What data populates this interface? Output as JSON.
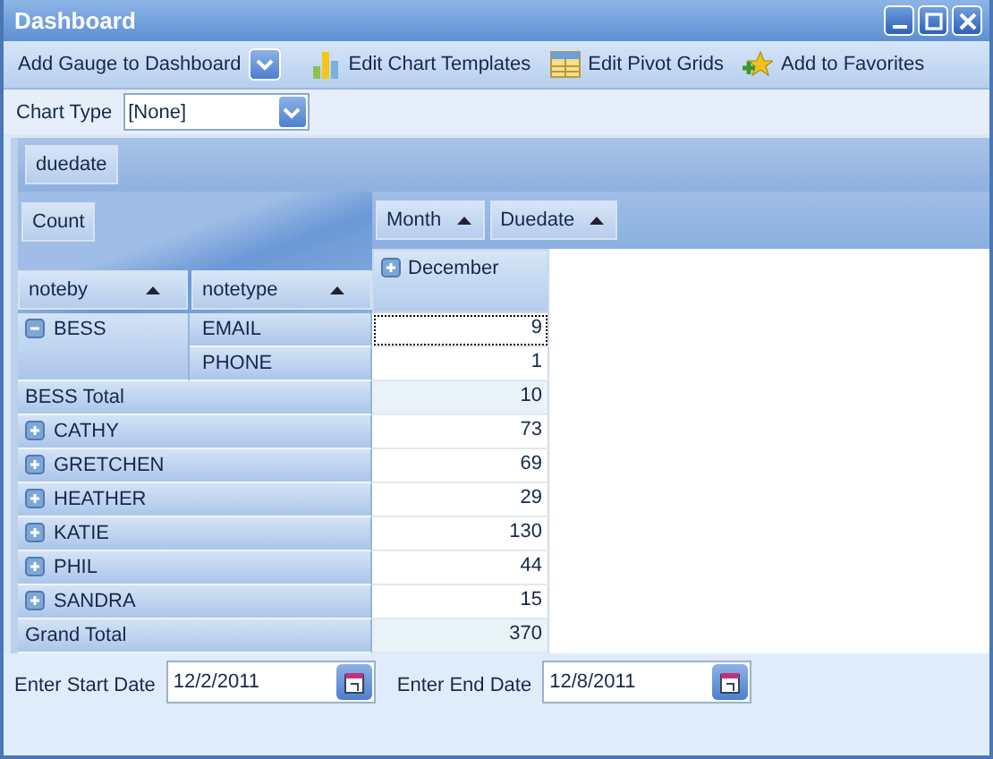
{
  "window": {
    "title": "Dashboard"
  },
  "toolbar": [
    {
      "label": "Add Gauge to Dashboard",
      "kind": "dropdown"
    },
    {
      "label": "Edit Chart Templates",
      "kind": "chart"
    },
    {
      "label": "Edit Pivot Grids",
      "kind": "grid"
    },
    {
      "label": "Add to Favorites",
      "kind": "favorite"
    }
  ],
  "chart_type": {
    "label": "Chart Type",
    "value": "[None]"
  },
  "pivot": {
    "filter_fields": [
      "duedate"
    ],
    "data_fields": [
      "Count"
    ],
    "column_fields": [
      "Month",
      "Duedate"
    ],
    "row_fields": [
      "noteby",
      "notetype"
    ],
    "column_values": [
      {
        "label": "December",
        "expanded": false
      }
    ],
    "rows": [
      {
        "kind": "member",
        "label": "BESS",
        "expanded": true,
        "children": [
          {
            "label": "EMAIL",
            "value": "9",
            "selected": true
          },
          {
            "label": "PHONE",
            "value": "1",
            "selected": false
          }
        ]
      },
      {
        "kind": "total",
        "label": "BESS Total",
        "value": "10",
        "selected": false
      },
      {
        "kind": "member",
        "label": "CATHY",
        "expanded": false,
        "value": "73",
        "selected": false
      },
      {
        "kind": "member",
        "label": "GRETCHEN",
        "expanded": false,
        "value": "69",
        "selected": false
      },
      {
        "kind": "member",
        "label": "HEATHER",
        "expanded": false,
        "value": "29",
        "selected": false
      },
      {
        "kind": "member",
        "label": "KATIE",
        "expanded": false,
        "value": "130",
        "selected": false
      },
      {
        "kind": "member",
        "label": "PHIL",
        "expanded": false,
        "value": "44",
        "selected": false
      },
      {
        "kind": "member",
        "label": "SANDRA",
        "expanded": false,
        "value": "15",
        "selected": false
      },
      {
        "kind": "total",
        "label": "Grand Total",
        "value": "370",
        "selected": false
      }
    ]
  },
  "dates": [
    {
      "label": "Enter Start Date",
      "value": "12/2/2011"
    },
    {
      "label": "Enter End Date",
      "value": "12/8/2011"
    }
  ]
}
